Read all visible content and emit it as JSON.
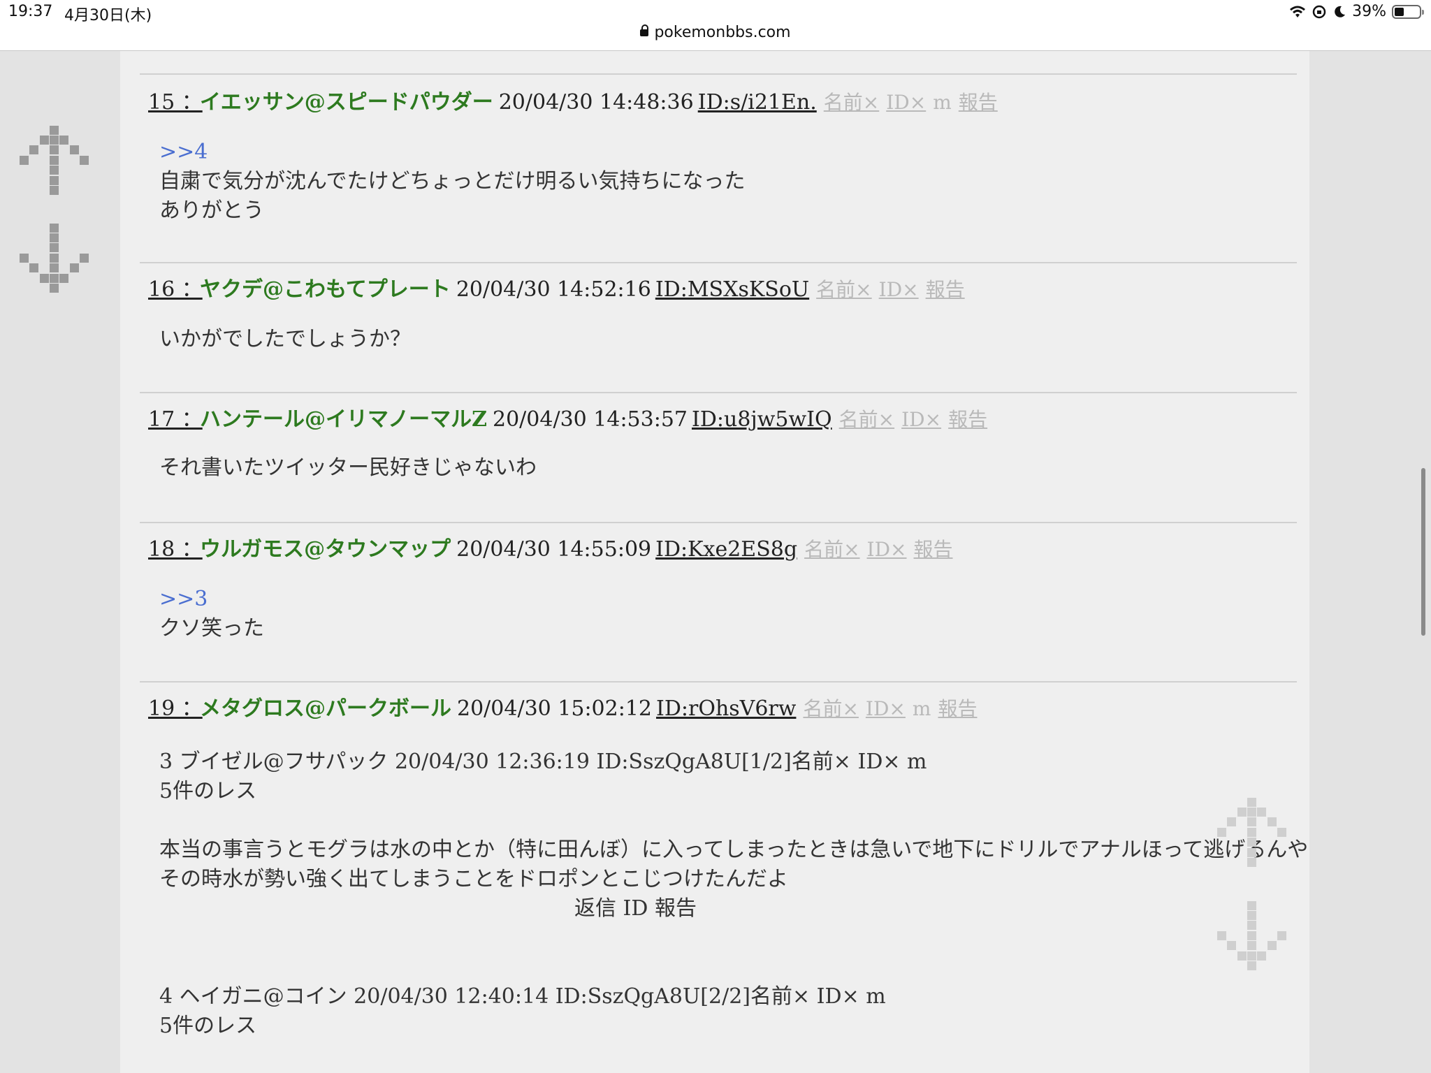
{
  "status": {
    "time": "19:37",
    "date": "4月30日(木)",
    "url": "pokemonbbs.com",
    "battery": "39%"
  },
  "posts": [
    {
      "num": "15 ：",
      "name": "イエッサン@スピードパウダー",
      "date": "20/04/30 14:48:36",
      "id": "ID:s/i21En.",
      "tools": [
        "名前×",
        "ID×",
        "m",
        "報告"
      ],
      "anchor": ">>4",
      "lines": [
        "自粛で気分が沈んでたけどちょっとだけ明るい気持ちになった",
        "ありがとう"
      ]
    },
    {
      "num": "16 ：",
      "name": "ヤクデ@こわもてプレート",
      "date": "20/04/30 14:52:16",
      "id": "ID:MSXsKSoU",
      "tools": [
        "名前×",
        "ID×",
        "報告"
      ],
      "lines": [
        "いかがでしたでしょうか？"
      ]
    },
    {
      "num": "17 ：",
      "name": "ハンテール@イリマノーマルZ",
      "date": "20/04/30 14:53:57",
      "id": "ID:u8jw5wIQ",
      "tools": [
        "名前×",
        "ID×",
        "報告"
      ],
      "lines": [
        "それ書いたツイッター民好きじゃないわ"
      ]
    },
    {
      "num": "18 ：",
      "name": "ウルガモス@タウンマップ",
      "date": "20/04/30 14:55:09",
      "id": "ID:Kxe2ES8g",
      "tools": [
        "名前×",
        "ID×",
        "報告"
      ],
      "anchor": ">>3",
      "lines": [
        "クソ笑った"
      ]
    },
    {
      "num": "19 ：",
      "name": "メタグロス@パークボール",
      "date": "20/04/30 15:02:12",
      "id": "ID:rOhsV6rw",
      "tools": [
        "名前×",
        "ID×",
        "m",
        "報告"
      ]
    }
  ],
  "quoted": [
    {
      "header": "3 ブイゼル@フサパック 20/04/30 12:36:19 ID:SszQgA8U[1/2]名前× ID× m",
      "replies": "5件のレス",
      "text": "本当の事言うとモグラは水の中とか（特に田んぼ）に入ってしまったときは急いで地下にドリルでアナルほって逃げるんや",
      "text2": "その時水が勢い強く出てしまうことをドロポンとこじつけたんだよ",
      "actions": "返信 ID 報告"
    },
    {
      "header": "4 ヘイガニ@コイン 20/04/30 12:40:14 ID:SszQgA8U[2/2]名前× ID× m",
      "replies": "5件のレス"
    }
  ]
}
